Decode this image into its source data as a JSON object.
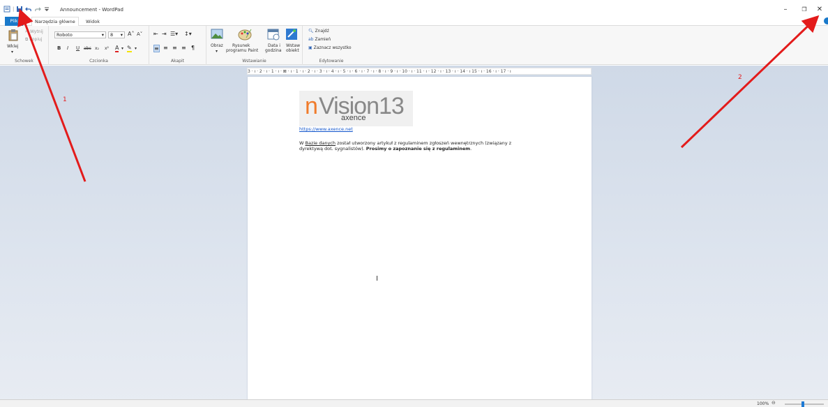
{
  "window": {
    "title": "Announcement - WordPad",
    "qat_separator": "|",
    "minimize": "–",
    "restore": "❐",
    "close": "✕"
  },
  "tabs": {
    "file": "Plik",
    "home": "Narzędzia główne",
    "view": "Widok"
  },
  "ribbon": {
    "clipboard": {
      "label": "Schowek",
      "paste": "Wklej",
      "cut": "Wytnij",
      "copy": "Kopiuj"
    },
    "font": {
      "label": "Czcionka",
      "family": "Roboto",
      "size": "8"
    },
    "paragraph": {
      "label": "Akapit"
    },
    "insert": {
      "label": "Wstawianie",
      "picture": "Obraz",
      "paint_line1": "Rysunek",
      "paint_line2": "programu Paint",
      "datetime_line1": "Data i",
      "datetime_line2": "godzina",
      "object_line1": "Wstaw",
      "object_line2": "obiekt"
    },
    "editing": {
      "label": "Edytowanie",
      "find": "Znajdź",
      "replace": "Zamień",
      "select_all": "Zaznacz wszystko"
    }
  },
  "ruler": {
    "text": "3 · ı · 2 · ı · 1 · ı · ⊠ · ı · 1 · ı · 2 · ı · 3 · ı · 4 · ı · 5 · ı · 6 · ı · 7 · ı · 8 · ı · 9 · ı · 10 · ı · 11 · ı · 12 · ı · 13 · ı · 14 · ı 15 · ı · 16 · ı · 17 · ı"
  },
  "document": {
    "logo_n": "n",
    "logo_rest": "Vision13",
    "logo_sub": "axence",
    "link": "https://www.axence.net",
    "para_part1": "W ",
    "para_link": "Bazie danych",
    "para_part2": " został utworzony artykuł z regulaminem zgłoszeń wewnętrznych (związany z dyrektywą dot. sygnalistów). ",
    "para_bold": "Prosimy o zapoznanie się z regulaminem",
    "para_end": "."
  },
  "status": {
    "zoom": "100%"
  },
  "annotations": {
    "arrow1": "1",
    "arrow2": "2"
  },
  "colors": {
    "file_tab": "#1979ca",
    "arrow": "#e31b1b"
  }
}
